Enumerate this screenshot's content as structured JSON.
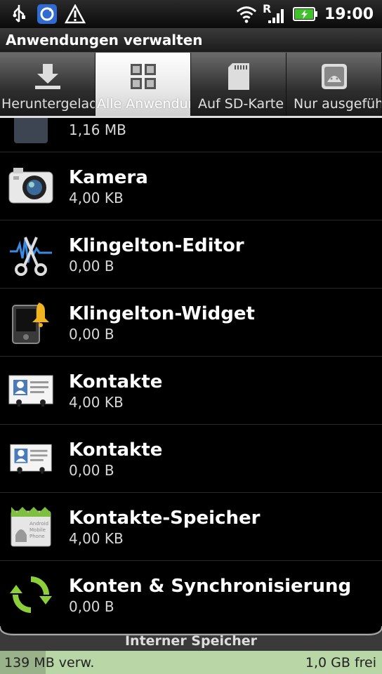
{
  "status_bar": {
    "icons_left": [
      "usb-icon",
      "sync-icon",
      "warning-icon"
    ],
    "icons_right": [
      "wifi-icon",
      "signal-roaming-icon",
      "battery-charging-icon"
    ],
    "roaming_letter": "R",
    "time": "19:00"
  },
  "title": "Anwendungen verwalten",
  "tabs": [
    {
      "label": "Heruntergelad",
      "icon": "download-icon",
      "active": false
    },
    {
      "label": "Alle Anwendun",
      "icon": "grid-icon",
      "active": true
    },
    {
      "label": "Auf SD-Karte",
      "icon": "sd-card-icon",
      "active": false
    },
    {
      "label": "Nur ausgeführ",
      "icon": "android-running-icon",
      "active": false
    }
  ],
  "apps": [
    {
      "name": "",
      "size": "1,16 MB",
      "icon": "partial-app-icon"
    },
    {
      "name": "Kamera",
      "size": "4,00 KB",
      "icon": "camera-icon"
    },
    {
      "name": "Klingelton-Editor",
      "size": "0,00 B",
      "icon": "scissors-waveform-icon"
    },
    {
      "name": "Klingelton-Widget",
      "size": "0,00 B",
      "icon": "phone-bell-icon"
    },
    {
      "name": "Kontakte",
      "size": "4,00 KB",
      "icon": "contact-card-icon"
    },
    {
      "name": "Kontakte",
      "size": "0,00 B",
      "icon": "contact-card-icon"
    },
    {
      "name": "Kontakte-Speicher",
      "size": "4,00 KB",
      "icon": "android-package-icon"
    },
    {
      "name": "Konten & Synchronisierung",
      "size": "0,00 B",
      "icon": "sync-arrows-icon"
    }
  ],
  "storage": {
    "label": "Interner Speicher",
    "used": "139 MB verw.",
    "free": "1,0 GB frei",
    "used_fraction": 0.12
  }
}
